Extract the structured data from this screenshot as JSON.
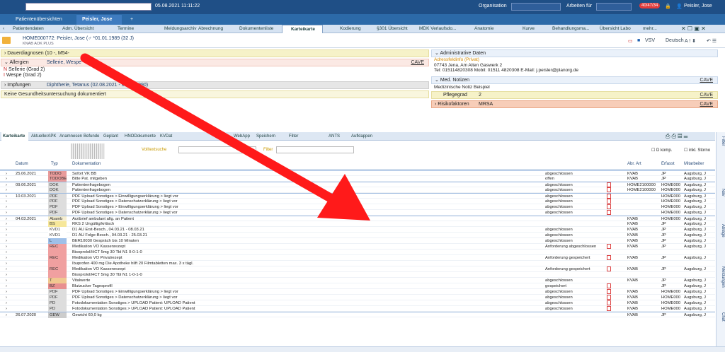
{
  "topbar": {
    "datetime": "05.08.2021 11:11:22",
    "org_label": "Organisation",
    "work_label": "Arbeiten für",
    "badge": "40/47/34",
    "user": "Peisler, Jose"
  },
  "patient_tabs": [
    "Patientenübersichten",
    "Peisler, Jose",
    "+"
  ],
  "nav_tabs": [
    "Patientendaten",
    "Adm. Übersicht",
    "Termine",
    "Meldungsarchiv",
    "Abrechnung",
    "Dokumentenliste",
    "Karteikarte",
    "Kodierung",
    "§301 Übersicht",
    "MDK Verlaufsdo...",
    "Anatomie",
    "Kurve",
    "Behandlungsma...",
    "Übersicht Labo",
    "mehr..."
  ],
  "patient": {
    "line": "HOME000772: Peisler, Jose (♂ *01.01.1989 (32 J)",
    "insurance": "KNAB AOK PLUS",
    "vsv": "VSV",
    "lang": "Deutsch"
  },
  "left_panel": {
    "dauer": "Dauerdiagnosen (10 -, M54-",
    "allergien_label": "Allergien",
    "allergien_value": "Sellerie, Wespe",
    "allergy_items": [
      "Sellerie (Grad 2)",
      "Wespe (Grad 2)"
    ],
    "impfungen_label": "Impfungen",
    "impfungen_value": "Diphtherie, Tetanus (02.08.2021 - 02.08.1990)",
    "gesund": "Keine Gesundheitsuntersuchung dokumentiert",
    "cave": "CAVE"
  },
  "right_panel": {
    "admin_title": "Administrative Daten",
    "admin_sub": "Adressfeldinfo (Privat)",
    "address": "07743 Jena, Am Alten Gaswerk 2",
    "contact": "Tel: 015114820308   Mobil: 01511 4820308   E-Mail: j.peisler@planorg.de",
    "med_title": "Med. Notizen",
    "med_note": "Medizinische Notiz Beispiel",
    "pflege_label": "Pflegegrad",
    "pflege_value": "2",
    "risk_label": "Risikofaktoren",
    "risk_value": "MRSA",
    "cave": "CAVE"
  },
  "kartei_tabs": [
    "Karteikarte",
    "AktuellerAPK",
    "Anamnesen",
    "Befunde",
    "Geplant",
    "HNODokumente",
    "KVDat",
    "WebApp",
    "Speichern",
    "Filter",
    "ANTS",
    "Aufklappen"
  ],
  "toolbar": {
    "volltext": "Volltextsuche",
    "filter": "Filter",
    "dkomp": "D komp.",
    "storno": "inkl. Storno"
  },
  "columns": [
    "Datum",
    "Typ",
    "Dokumentation",
    "Abr. Art",
    "Erfasst",
    "Mitarbeiter"
  ],
  "rows": [
    {
      "date": "25.06.2021",
      "type": "TODO",
      "doc": "Sofort VK BB",
      "status": "abgeschlossen",
      "abr": "KVAB",
      "erf": "JP",
      "ma": "Augsburg, J",
      "c": "#e89b9b",
      "head": true
    },
    {
      "date": "",
      "type": "TODOBE",
      "doc": "Bitte Pat. mitgeben",
      "status": "offen",
      "abr": "KVAB",
      "erf": "JP",
      "ma": "Augsburg, J",
      "c": "#e89b9b"
    },
    {
      "date": "09.06.2021",
      "type": "DOK",
      "doc": "Patientenfragebogen",
      "status": "abgeschlossen",
      "abr": "HOME2100000",
      "erf": "HOME000",
      "ma": "Augsburg, J",
      "c": "#dddddd",
      "head": true
    },
    {
      "date": "",
      "type": "DOK",
      "doc": "Patientenfragebogen",
      "status": "abgeschlossen",
      "abr": "HOME2100000",
      "erf": "HOME000",
      "ma": "Augsburg, J",
      "c": "#dddddd"
    },
    {
      "date": "10.03.2021",
      "type": "PDF",
      "doc": "PDF Upload Sonstiges > Einwilligungserklärung > liegt vor",
      "status": "abgeschlossen",
      "abr": "",
      "erf": "HOME000",
      "ma": "Augsburg, J",
      "c": "#dddddd",
      "head": true
    },
    {
      "date": "",
      "type": "PDF",
      "doc": "PDF Upload Sonstiges > Datenschutzerklärung > liegt vor",
      "status": "abgeschlossen",
      "abr": "",
      "erf": "HOME000",
      "ma": "Augsburg, J",
      "c": "#dddddd"
    },
    {
      "date": "",
      "type": "PDF",
      "doc": "PDF Upload Sonstiges > Einwilligungserklärung > liegt vor",
      "status": "abgeschlossen",
      "abr": "",
      "erf": "HOME000",
      "ma": "Augsburg, J",
      "c": "#dddddd"
    },
    {
      "date": "",
      "type": "PDF",
      "doc": "PDF Upload Sonstiges > Datenschutzerklärung > liegt vor",
      "status": "abgeschlossen",
      "abr": "",
      "erf": "HOME000",
      "ma": "Augsburg, J",
      "c": "#dddddd"
    },
    {
      "date": "04.03.2021",
      "type": "Abamb",
      "doc": "Arztbrief ambulant allg. an Patient",
      "status": "",
      "abr": "KVAB",
      "erf": "HOME000",
      "ma": "Augsburg, J",
      "c": "#f6eecf",
      "head": true
    },
    {
      "date": "",
      "type": "BS",
      "doc": "RKS 2    Ungültig/kritisch",
      "status": "",
      "abr": "KVAB",
      "erf": "JP",
      "ma": "Augsburg, J",
      "c": "#f6e79a"
    },
    {
      "date": "",
      "type": "KVD1",
      "doc": "D1 AU   Erst-Besch., 04.03.21 - 08.03.21",
      "status": "abgeschlossen",
      "abr": "KVAB",
      "erf": "JP",
      "ma": "Augsburg, J",
      "c": "#ffffff"
    },
    {
      "date": "",
      "type": "KVD1",
      "doc": "D1 AU   Folge-Besch., 04.03.21 - 25.03.21",
      "status": "abgeschlossen",
      "abr": "KVAB",
      "erf": "JP",
      "ma": "Augsburg, J",
      "c": "#ffffff"
    },
    {
      "date": "",
      "type": "L",
      "doc": "BER10030  Gespräch bis 10 Minuten",
      "status": "abgeschlossen",
      "abr": "KVAB",
      "erf": "JP",
      "ma": "Augsburg, J",
      "c": "#9fc0e8"
    },
    {
      "date": "",
      "type": "REC",
      "doc": "Medikation VO Kassenrezept",
      "status": "Anforderung abgeschlossen",
      "abr": "KVAB",
      "erf": "JP",
      "ma": "Augsburg, J",
      "c": "#f0a0a0"
    },
    {
      "date": "",
      "type": "",
      "doc": "    Bisoprolol/HCT 5mg 30 Tbl N1   0-0-1-0",
      "status": "",
      "abr": "",
      "erf": "",
      "ma": "",
      "c": "#f0a0a0"
    },
    {
      "date": "",
      "type": "REC",
      "doc": "Medikation VO Privatrezept",
      "status": "Anforderung gespeichert",
      "abr": "KVAB",
      "erf": "JP",
      "ma": "Augsburg, J",
      "c": "#f0a0a0"
    },
    {
      "date": "",
      "type": "",
      "doc": "    Ibuprofen 400 mg Die Apotheke hilft 20 Filmtabletten   max. 3 x tägl.",
      "status": "",
      "abr": "",
      "erf": "",
      "ma": "",
      "c": "#f0a0a0"
    },
    {
      "date": "",
      "type": "REC",
      "doc": "Medikation VO Kassenrezept",
      "status": "Anforderung gespeichert",
      "abr": "KVAB",
      "erf": "JP",
      "ma": "Augsburg, J",
      "c": "#f0a0a0"
    },
    {
      "date": "",
      "type": "",
      "doc": "    Bisoprolol/HCT 5mg 30 Tbl N1   1-0-1-0",
      "status": "",
      "abr": "",
      "erf": "",
      "ma": "",
      "c": "#f0a0a0"
    },
    {
      "date": "",
      "type": "T",
      "doc": "Vitalwerte",
      "status": "abgeschlossen",
      "abr": "KVAB",
      "erf": "JP",
      "ma": "Augsburg, J",
      "c": "#f0c890"
    },
    {
      "date": "",
      "type": "BZ",
      "doc": "Blutzucker Tagesprofil",
      "status": "gespeichert",
      "abr": "",
      "erf": "JP",
      "ma": "Augsburg, J",
      "c": "#e89090"
    },
    {
      "date": "",
      "type": "PDF",
      "doc": "PDF Upload Sonstiges > Einwilligungserklärung > liegt vor",
      "status": "abgeschlossen",
      "abr": "KVAB",
      "erf": "HOME000",
      "ma": "Augsburg, J",
      "c": "#dddddd"
    },
    {
      "date": "",
      "type": "PDF",
      "doc": "PDF Upload Sonstiges > Datenschutzerklärung > liegt vor",
      "status": "abgeschlossen",
      "abr": "KVAB",
      "erf": "HOME000",
      "ma": "Augsburg, J",
      "c": "#dddddd"
    },
    {
      "date": "",
      "type": "PD",
      "doc": "Fotodokumentation Sonstiges > UPLOAD Patient: UPLOAD Patient",
      "status": "abgeschlossen",
      "abr": "KVAB",
      "erf": "HOME000",
      "ma": "Augsburg, J",
      "c": "#dddddd"
    },
    {
      "date": "",
      "type": "PD",
      "doc": "Fotodokumentation Sonstiges > UPLOAD Patient: UPLOAD Patient",
      "status": "abgeschlossen",
      "abr": "KVAB",
      "erf": "HOME000",
      "ma": "Augsburg, J",
      "c": "#dddddd"
    },
    {
      "date": "26.07.2020",
      "type": "GEW",
      "doc": "Gewicht           60,0  kg",
      "status": "",
      "abr": "KVAB",
      "erf": "JP",
      "ma": "Augsburg, J",
      "c": "#cccccc",
      "head": true
    }
  ],
  "sidebar": [
    "Filter",
    "Nav",
    "Ablage",
    "Meldungen",
    "Chat"
  ],
  "colors": {
    "header": "#1f4f86",
    "arrow": "#ff1a1a",
    "accent": "#3f7cc0"
  }
}
